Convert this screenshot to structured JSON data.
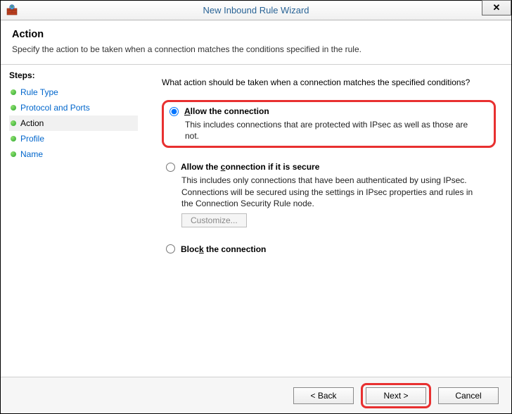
{
  "window": {
    "title": "New Inbound Rule Wizard",
    "close_glyph": "✕"
  },
  "header": {
    "title": "Action",
    "subtitle": "Specify the action to be taken when a connection matches the conditions specified in the rule."
  },
  "sidebar": {
    "steps_label": "Steps:",
    "items": [
      {
        "label": "Rule Type",
        "active": false
      },
      {
        "label": "Protocol and Ports",
        "active": false
      },
      {
        "label": "Action",
        "active": true
      },
      {
        "label": "Profile",
        "active": false
      },
      {
        "label": "Name",
        "active": false
      }
    ]
  },
  "content": {
    "prompt": "What action should be taken when a connection matches the specified conditions?",
    "options": [
      {
        "id": "allow",
        "title_pre": "A",
        "title_rest": "llow the connection",
        "desc": "This includes connections that are protected with IPsec as well as those are not.",
        "selected": true,
        "highlighted": true
      },
      {
        "id": "allow-secure",
        "title_pre": "Allow the ",
        "title_u": "c",
        "title_rest": "onnection if it is secure",
        "desc": "This includes only connections that have been authenticated by using IPsec. Connections will be secured using the settings in IPsec properties and rules in the Connection Security Rule node.",
        "selected": false,
        "customize_label": "Customize..."
      },
      {
        "id": "block",
        "title_pre": "Bloc",
        "title_u": "k",
        "title_rest": " the connection",
        "selected": false
      }
    ]
  },
  "footer": {
    "back": "< Back",
    "next": "Next >",
    "cancel": "Cancel"
  }
}
